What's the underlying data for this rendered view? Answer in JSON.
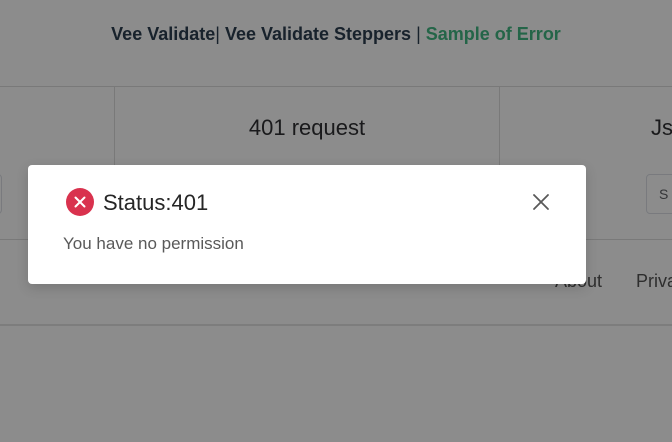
{
  "nav": {
    "link1": "Vee Validate",
    "sep1": "|",
    "link2": "Vee Validate Steppers",
    "sep2": "|",
    "link3": "Sample of Error",
    "active_color": "#42b983"
  },
  "cards": {
    "middle_title": "401 request",
    "right_title": "Js",
    "right_button": "S"
  },
  "footer": {
    "about": "About",
    "privacy": "Priva"
  },
  "modal": {
    "icon": "error-circle-icon",
    "icon_color": "#d9324e",
    "title": "Status:401",
    "message": "You have no permission",
    "close_icon": "close-icon"
  }
}
